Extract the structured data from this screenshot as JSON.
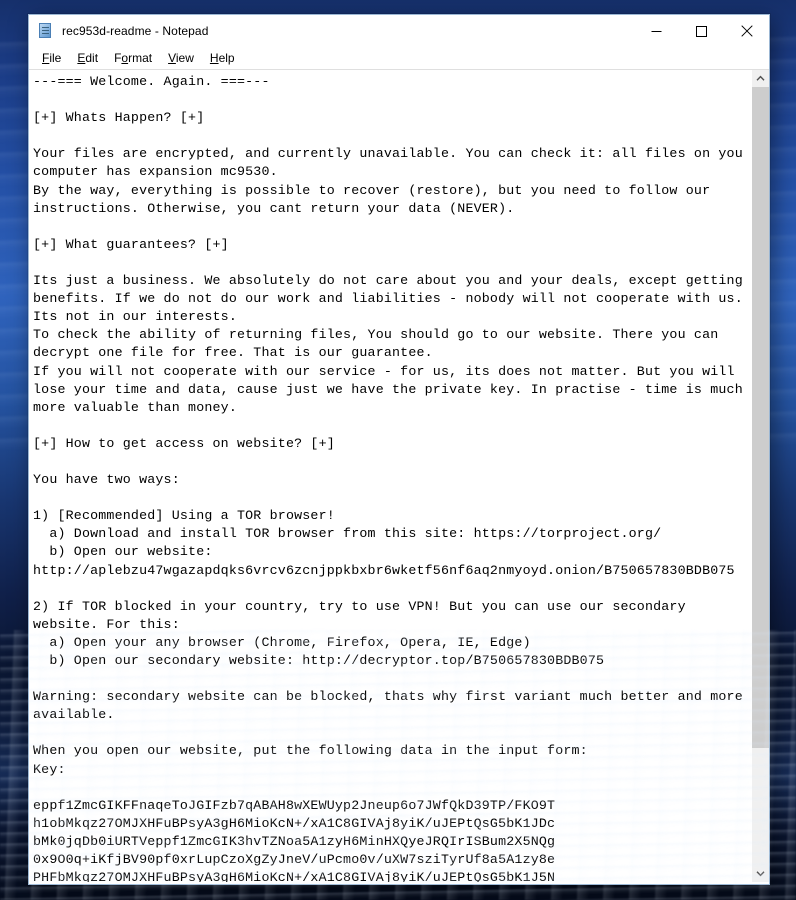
{
  "desktop": {
    "wallpaper_name": "windows-blue-sky-wallpaper",
    "accent_color": "#1b3c86"
  },
  "window": {
    "title": "rec953d-readme - Notepad",
    "icon": "notepad-icon",
    "controls": {
      "minimize_label": "Minimize",
      "maximize_label": "Maximize",
      "close_label": "Close"
    }
  },
  "menu": {
    "items": [
      {
        "label": "File",
        "mnemonic": "F",
        "rest": "ile"
      },
      {
        "label": "Edit",
        "mnemonic": "E",
        "rest": "dit"
      },
      {
        "label": "Format",
        "pre": "F",
        "mnemonic": "o",
        "rest": "rmat"
      },
      {
        "label": "View",
        "mnemonic": "V",
        "rest": "iew"
      },
      {
        "label": "Help",
        "mnemonic": "H",
        "rest": "elp"
      }
    ]
  },
  "document": {
    "filename": "rec953d-readme",
    "body": "---=== Welcome. Again. ===---\n\n[+] Whats Happen? [+]\n\nYour files are encrypted, and currently unavailable. You can check it: all files on you\ncomputer has expansion mc9530.\nBy the way, everything is possible to recover (restore), but you need to follow our\ninstructions. Otherwise, you cant return your data (NEVER).\n\n[+] What guarantees? [+]\n\nIts just a business. We absolutely do not care about you and your deals, except getting\nbenefits. If we do not do our work and liabilities - nobody will not cooperate with us.\nIts not in our interests.\nTo check the ability of returning files, You should go to our website. There you can\ndecrypt one file for free. That is our guarantee.\nIf you will not cooperate with our service - for us, its does not matter. But you will\nlose your time and data, cause just we have the private key. In practise - time is much\nmore valuable than money.\n\n[+] How to get access on website? [+]\n\nYou have two ways:\n\n1) [Recommended] Using a TOR browser!\n  a) Download and install TOR browser from this site: https://torproject.org/\n  b) Open our website:\nhttp://aplebzu47wgazapdqks6vrcv6zcnjppkbxbr6wketf56nf6aq2nmyoyd.onion/B750657830BDB075\n\n2) If TOR blocked in your country, try to use VPN! But you can use our secondary\nwebsite. For this:\n  a) Open your any browser (Chrome, Firefox, Opera, IE, Edge)\n  b) Open our secondary website: http://decryptor.top/B750657830BDB075\n\nWarning: secondary website can be blocked, thats why first variant much better and more\navailable.\n\nWhen you open our website, put the following data in the input form:\nKey:\n\neppf1ZmcGIKFFnaqeToJGIFzb7qABAH8wXEWUyp2Jneup6o7JWfQkD39TP/FKO9T\nh1obMkqz27OMJXHFuBPsyA3gH6MioKcN+/xA1C8GIVAj8yiK/uJEPtQsG5bK1JDc\nbMk0jqDb0iURTVeppf1ZmcGIK3hvTZNoa5A1zyH6MinHXQyeJRQIrISBum2X5NQg\n0x9O0q+iKfjBV90pf0xrLupCzoXgZyJneV/uPcmo0v/uXW7sziTyrUf8a5A1zy8e\nPHFbMkqz27OMJXHFuBPsyA3gH6MioKcN+/xA1C8GIVAj8yiK/uJEPtQsG5bK1J5N",
    "ransom_note_details": {
      "encrypted_extension": "mc9530",
      "tor_url": "http://aplebzu47wgazapdqks6vrcv6zcnjppkbxbr6wketf56nf6aq2nmyoyd.onion/B750657830BDB075",
      "secondary_url": "http://decryptor.top/B750657830BDB075",
      "tor_download_site": "https://torproject.org/",
      "victim_id": "B750657830BDB075"
    }
  },
  "scrollbar": {
    "up_arrow": "chevron-up-icon",
    "down_arrow": "chevron-down-icon",
    "thumb_position_percent": 0,
    "thumb_size_percent": 85
  }
}
